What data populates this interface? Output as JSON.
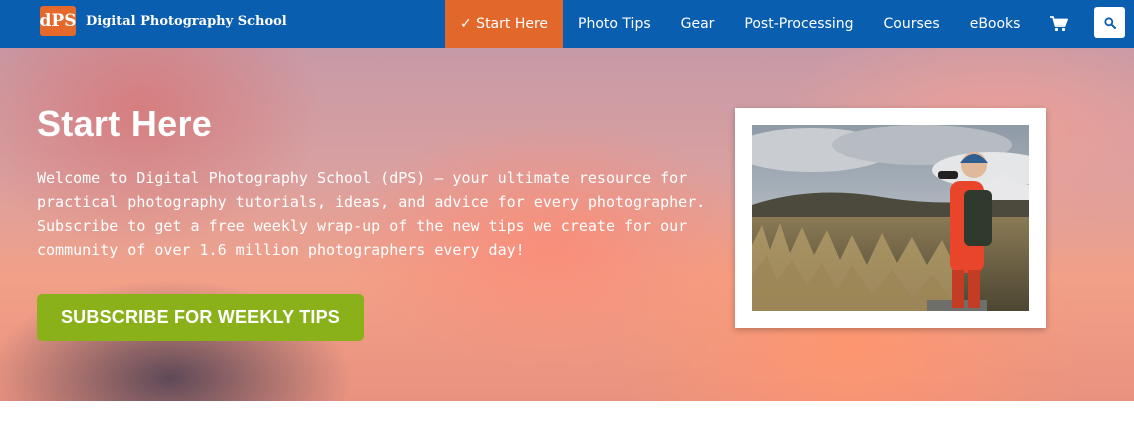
{
  "header": {
    "logo_mark": "dPS",
    "logo_text": "Digital Photography School",
    "nav": [
      {
        "label": "✓ Start Here",
        "active": true
      },
      {
        "label": "Photo Tips"
      },
      {
        "label": "Gear"
      },
      {
        "label": "Post-Processing"
      },
      {
        "label": "Courses"
      },
      {
        "label": "eBooks"
      }
    ],
    "cart_icon": "shopping-cart-icon",
    "search_icon": "search-icon"
  },
  "hero": {
    "title": "Start Here",
    "text": "Welcome to Digital Photography School (dPS) – your ultimate resource for practical photography tutorials, ideas, and advice for every photographer. Subscribe to get a free weekly wrap-up of the new tips we create for our community of over 1.6 million photographers every day!",
    "subscribe_label": "SUBSCRIBE FOR WEEKLY TIPS"
  },
  "colors": {
    "header_bg": "#0a5eb0",
    "nav_active": "#e2672a",
    "subscribe_bg": "#8ab11a"
  }
}
